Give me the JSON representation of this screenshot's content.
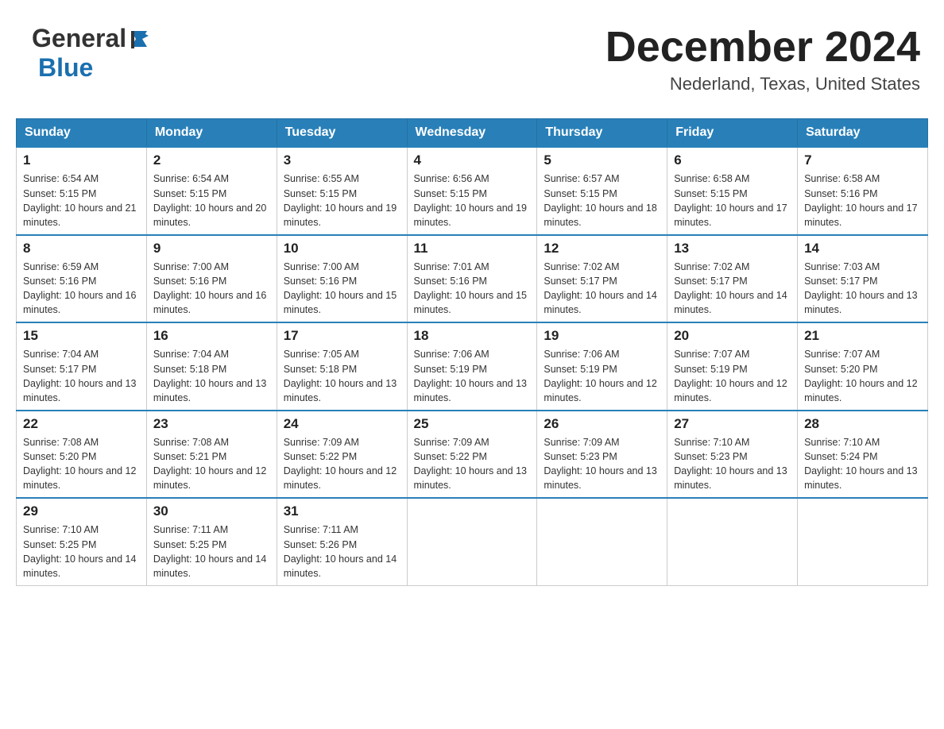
{
  "header": {
    "logo_general": "General",
    "logo_blue": "Blue",
    "month_title": "December 2024",
    "location": "Nederland, Texas, United States"
  },
  "weekdays": [
    "Sunday",
    "Monday",
    "Tuesday",
    "Wednesday",
    "Thursday",
    "Friday",
    "Saturday"
  ],
  "weeks": [
    [
      {
        "day": "1",
        "sunrise": "6:54 AM",
        "sunset": "5:15 PM",
        "daylight": "10 hours and 21 minutes."
      },
      {
        "day": "2",
        "sunrise": "6:54 AM",
        "sunset": "5:15 PM",
        "daylight": "10 hours and 20 minutes."
      },
      {
        "day": "3",
        "sunrise": "6:55 AM",
        "sunset": "5:15 PM",
        "daylight": "10 hours and 19 minutes."
      },
      {
        "day": "4",
        "sunrise": "6:56 AM",
        "sunset": "5:15 PM",
        "daylight": "10 hours and 19 minutes."
      },
      {
        "day": "5",
        "sunrise": "6:57 AM",
        "sunset": "5:15 PM",
        "daylight": "10 hours and 18 minutes."
      },
      {
        "day": "6",
        "sunrise": "6:58 AM",
        "sunset": "5:15 PM",
        "daylight": "10 hours and 17 minutes."
      },
      {
        "day": "7",
        "sunrise": "6:58 AM",
        "sunset": "5:16 PM",
        "daylight": "10 hours and 17 minutes."
      }
    ],
    [
      {
        "day": "8",
        "sunrise": "6:59 AM",
        "sunset": "5:16 PM",
        "daylight": "10 hours and 16 minutes."
      },
      {
        "day": "9",
        "sunrise": "7:00 AM",
        "sunset": "5:16 PM",
        "daylight": "10 hours and 16 minutes."
      },
      {
        "day": "10",
        "sunrise": "7:00 AM",
        "sunset": "5:16 PM",
        "daylight": "10 hours and 15 minutes."
      },
      {
        "day": "11",
        "sunrise": "7:01 AM",
        "sunset": "5:16 PM",
        "daylight": "10 hours and 15 minutes."
      },
      {
        "day": "12",
        "sunrise": "7:02 AM",
        "sunset": "5:17 PM",
        "daylight": "10 hours and 14 minutes."
      },
      {
        "day": "13",
        "sunrise": "7:02 AM",
        "sunset": "5:17 PM",
        "daylight": "10 hours and 14 minutes."
      },
      {
        "day": "14",
        "sunrise": "7:03 AM",
        "sunset": "5:17 PM",
        "daylight": "10 hours and 13 minutes."
      }
    ],
    [
      {
        "day": "15",
        "sunrise": "7:04 AM",
        "sunset": "5:17 PM",
        "daylight": "10 hours and 13 minutes."
      },
      {
        "day": "16",
        "sunrise": "7:04 AM",
        "sunset": "5:18 PM",
        "daylight": "10 hours and 13 minutes."
      },
      {
        "day": "17",
        "sunrise": "7:05 AM",
        "sunset": "5:18 PM",
        "daylight": "10 hours and 13 minutes."
      },
      {
        "day": "18",
        "sunrise": "7:06 AM",
        "sunset": "5:19 PM",
        "daylight": "10 hours and 13 minutes."
      },
      {
        "day": "19",
        "sunrise": "7:06 AM",
        "sunset": "5:19 PM",
        "daylight": "10 hours and 12 minutes."
      },
      {
        "day": "20",
        "sunrise": "7:07 AM",
        "sunset": "5:19 PM",
        "daylight": "10 hours and 12 minutes."
      },
      {
        "day": "21",
        "sunrise": "7:07 AM",
        "sunset": "5:20 PM",
        "daylight": "10 hours and 12 minutes."
      }
    ],
    [
      {
        "day": "22",
        "sunrise": "7:08 AM",
        "sunset": "5:20 PM",
        "daylight": "10 hours and 12 minutes."
      },
      {
        "day": "23",
        "sunrise": "7:08 AM",
        "sunset": "5:21 PM",
        "daylight": "10 hours and 12 minutes."
      },
      {
        "day": "24",
        "sunrise": "7:09 AM",
        "sunset": "5:22 PM",
        "daylight": "10 hours and 12 minutes."
      },
      {
        "day": "25",
        "sunrise": "7:09 AM",
        "sunset": "5:22 PM",
        "daylight": "10 hours and 13 minutes."
      },
      {
        "day": "26",
        "sunrise": "7:09 AM",
        "sunset": "5:23 PM",
        "daylight": "10 hours and 13 minutes."
      },
      {
        "day": "27",
        "sunrise": "7:10 AM",
        "sunset": "5:23 PM",
        "daylight": "10 hours and 13 minutes."
      },
      {
        "day": "28",
        "sunrise": "7:10 AM",
        "sunset": "5:24 PM",
        "daylight": "10 hours and 13 minutes."
      }
    ],
    [
      {
        "day": "29",
        "sunrise": "7:10 AM",
        "sunset": "5:25 PM",
        "daylight": "10 hours and 14 minutes."
      },
      {
        "day": "30",
        "sunrise": "7:11 AM",
        "sunset": "5:25 PM",
        "daylight": "10 hours and 14 minutes."
      },
      {
        "day": "31",
        "sunrise": "7:11 AM",
        "sunset": "5:26 PM",
        "daylight": "10 hours and 14 minutes."
      },
      null,
      null,
      null,
      null
    ]
  ]
}
